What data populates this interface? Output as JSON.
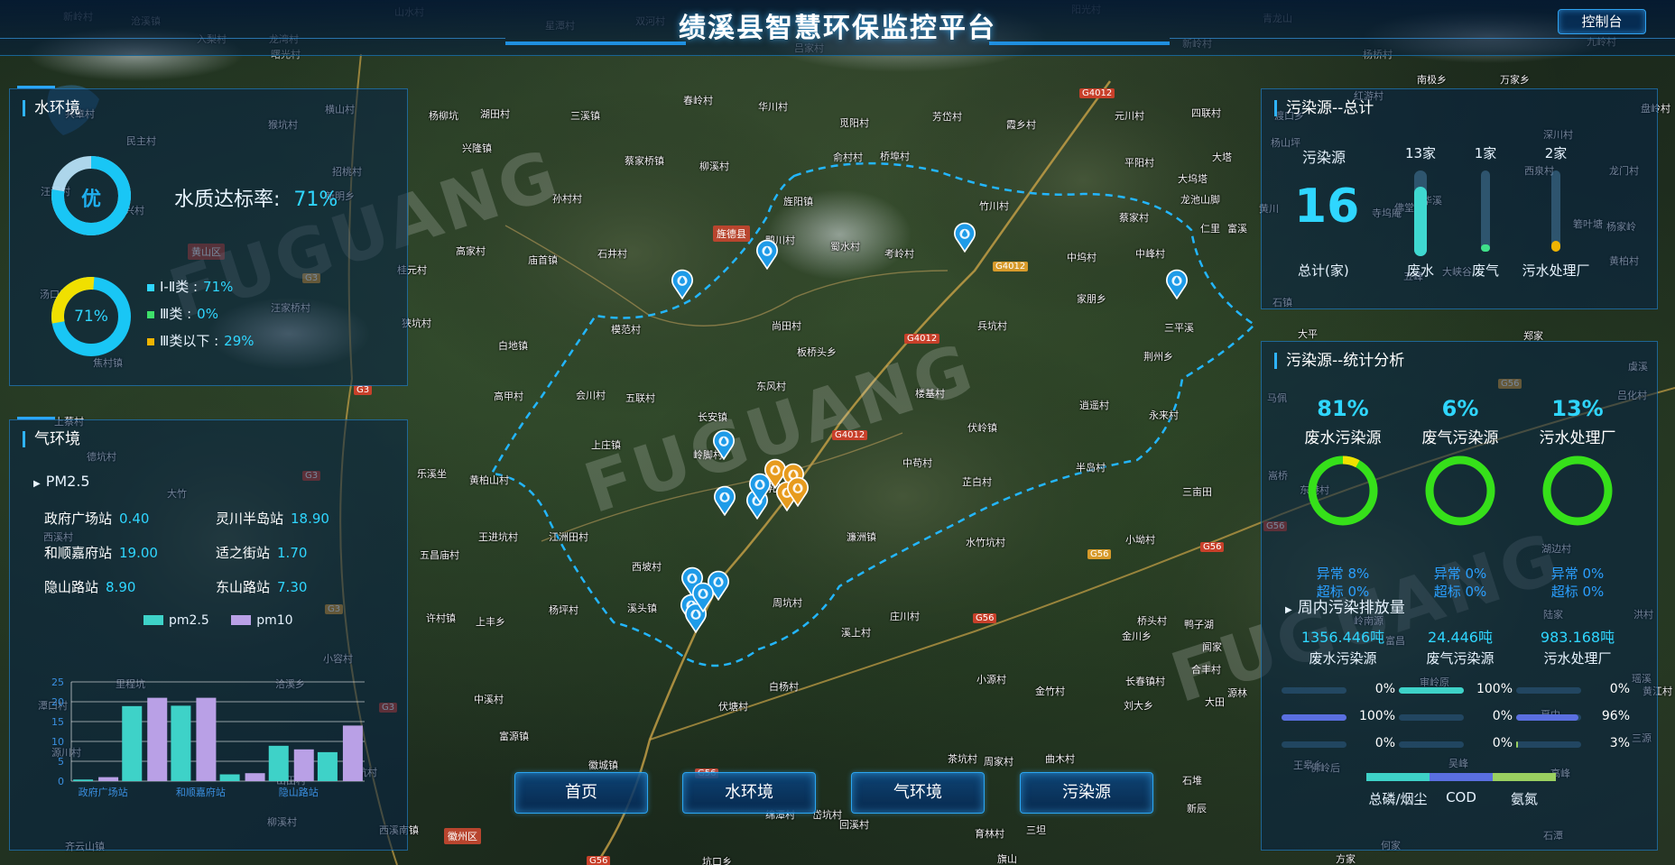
{
  "header": {
    "title": "绩溪县智慧环保监控平台",
    "console_label": "控制台",
    "map_labels_top": [
      "新岭村",
      "沧溪镇",
      "入梨村",
      "龙湾村",
      "山水村",
      "星潭村",
      "双河村",
      "吕家村",
      "阳光村",
      "青龙山",
      "九岭村",
      "杨桥村",
      "曙光村",
      "新岭村"
    ]
  },
  "water": {
    "title": "水环境",
    "grade": "优",
    "rate_label": "水质达标率:",
    "rate_value": "71%",
    "donut_value": "71%",
    "legend": [
      {
        "label": "Ⅰ-Ⅱ类 :",
        "value": "71%",
        "color": "#2fd6ff"
      },
      {
        "label": "Ⅲ类 :",
        "value": "0%",
        "color": "#3ee06a"
      },
      {
        "label": "Ⅲ类以下 :",
        "value": "29%",
        "color": "#f0b400"
      }
    ]
  },
  "air": {
    "title": "气环境",
    "pm_label": "PM2.5",
    "stations": [
      {
        "name": "政府广场站",
        "value": "0.40"
      },
      {
        "name": "灵川半岛站",
        "value": "18.90"
      },
      {
        "name": "和顺嘉府站",
        "value": "19.00"
      },
      {
        "name": "适之街站",
        "value": "1.70"
      },
      {
        "name": "隐山路站",
        "value": "8.90"
      },
      {
        "name": "东山路站",
        "value": "7.30"
      }
    ],
    "legend_pm25": "pm2.5",
    "legend_pm10": "pm10",
    "pm25_color": "#3ed2c8",
    "pm10_color": "#b9a0e6"
  },
  "chart_data": {
    "type": "bar",
    "categories": [
      "政府广场站",
      "灵川半岛站",
      "和顺嘉府站",
      "适之街站",
      "隐山路站",
      "东山路站"
    ],
    "tick_labels": [
      "政府广场站",
      "和顺嘉府站",
      "隐山路站"
    ],
    "series": [
      {
        "name": "pm2.5",
        "values": [
          0.4,
          18.9,
          19.0,
          1.7,
          8.9,
          7.3
        ]
      },
      {
        "name": "pm10",
        "values": [
          1.0,
          21.0,
          21.0,
          2.0,
          8.0,
          14.0
        ]
      }
    ],
    "y_ticks": [
      "0",
      "5",
      "10",
      "15",
      "20",
      "25"
    ],
    "ylim": [
      0,
      25
    ],
    "grid": true,
    "legend": "top"
  },
  "pollution_total": {
    "title": "污染源--总计",
    "source_label": "污染源",
    "total": "16",
    "total_label": "总计(家)",
    "columns": [
      {
        "count": "13家",
        "label": "废水",
        "fill": 0.81,
        "color": "#3fd8d0"
      },
      {
        "count": "1家",
        "label": "废气",
        "fill": 0.06,
        "color": "#3fe08a"
      },
      {
        "count": "2家",
        "label": "污水处理厂",
        "fill": 0.13,
        "color": "#f0b400"
      }
    ]
  },
  "pollution_stats": {
    "title": "污染源--统计分析",
    "items": [
      {
        "pct": "81%",
        "label": "废水污染源",
        "abnormal": "异常 8%",
        "exceed": "超标 0%",
        "ring_fill": 0.08
      },
      {
        "pct": "6%",
        "label": "废气污染源",
        "abnormal": "异常 0%",
        "exceed": "超标 0%",
        "ring_fill": 0
      },
      {
        "pct": "13%",
        "label": "污水处理厂",
        "abnormal": "异常 0%",
        "exceed": "超标 0%",
        "ring_fill": 0
      }
    ],
    "weekly_title": "周内污染排放量",
    "weekly": [
      {
        "amount": "1356.446吨",
        "label": "废水污染源"
      },
      {
        "amount": "24.446吨",
        "label": "废气污染源"
      },
      {
        "amount": "983.168吨",
        "label": "污水处理厂"
      }
    ],
    "bars": [
      [
        {
          "pct": "0%",
          "fill": 0
        },
        {
          "pct": "100%",
          "fill": 1.0
        },
        {
          "pct": "0%",
          "fill": 0
        }
      ],
      [
        {
          "pct": "100%",
          "fill": 1.0
        },
        {
          "pct": "0%",
          "fill": 0
        },
        {
          "pct": "96%",
          "fill": 0.96
        }
      ],
      [
        {
          "pct": "0%",
          "fill": 0
        },
        {
          "pct": "0%",
          "fill": 0
        },
        {
          "pct": "3%",
          "fill": 0.03
        }
      ]
    ],
    "bar_colors": [
      "#3ed2c8",
      "#5a6fe0",
      "#9ad060"
    ],
    "legend": [
      "总磷/烟尘",
      "COD",
      "氨氮"
    ]
  },
  "nav": {
    "home": "首页",
    "water": "水环境",
    "air": "气环境",
    "pollution": "污染源"
  },
  "map": {
    "labels": [
      [
        "共章村",
        72,
        118
      ],
      [
        "民主村",
        140,
        148
      ],
      [
        "汪洞村",
        45,
        204
      ],
      [
        "兴村",
        138,
        225
      ],
      [
        "黄山区",
        208,
        270
      ],
      [
        "汤口镇",
        44,
        318
      ],
      [
        "汪家桥村",
        300,
        333
      ],
      [
        "招桃村",
        368,
        182
      ],
      [
        "新明乡",
        360,
        209
      ],
      [
        "桂元村",
        440,
        291
      ],
      [
        "狭坑村",
        445,
        350
      ],
      [
        "杨柳坑",
        475,
        120
      ],
      [
        "湖田村",
        532,
        118
      ],
      [
        "兴隆镇",
        512,
        156
      ],
      [
        "三溪镇",
        632,
        120
      ],
      [
        "蔡家桥镇",
        692,
        170
      ],
      [
        "孙村村",
        612,
        212
      ],
      [
        "石井村",
        662,
        273
      ],
      [
        "庙首镇",
        585,
        280
      ],
      [
        "高家村",
        505,
        270
      ],
      [
        "白地镇",
        552,
        375
      ],
      [
        "高甲村",
        547,
        431
      ],
      [
        "模范村",
        677,
        357
      ],
      [
        "会川村",
        638,
        430
      ],
      [
        "五联村",
        693,
        433
      ],
      [
        "上庄镇",
        655,
        485
      ],
      [
        "乐溪坐",
        462,
        517
      ],
      [
        "黄柏山村",
        520,
        524
      ],
      [
        "王进坑村",
        530,
        587
      ],
      [
        "五昌庙村",
        465,
        607
      ],
      [
        "许村镇",
        472,
        677
      ],
      [
        "上丰乡",
        527,
        681
      ],
      [
        "中溪村",
        525,
        767
      ],
      [
        "富源镇",
        553,
        808
      ],
      [
        "徽城镇",
        652,
        840
      ],
      [
        "伏塘村",
        796,
        775
      ],
      [
        "春岭村",
        757,
        103
      ],
      [
        "华川村",
        840,
        110
      ],
      [
        "柳溪村",
        775,
        176
      ],
      [
        "旌阳镇",
        868,
        215
      ],
      [
        "鸭川村",
        848,
        258
      ],
      [
        "尚田村",
        855,
        353
      ],
      [
        "板桥头乡",
        883,
        382
      ],
      [
        "东风村",
        838,
        420
      ],
      [
        "长安镇",
        773,
        454
      ],
      [
        "岭脚村",
        768,
        496
      ],
      [
        "乳坑村",
        850,
        533
      ],
      [
        "西坡村",
        700,
        620
      ],
      [
        "溪头镇",
        695,
        666
      ],
      [
        "杨坪村",
        608,
        668
      ],
      [
        "江洲田村",
        608,
        587
      ],
      [
        "周坑村",
        856,
        660
      ],
      [
        "白杨村",
        852,
        753
      ],
      [
        "溪上村",
        932,
        693
      ],
      [
        "庄川村",
        986,
        675
      ],
      [
        "濂洲镇",
        938,
        587
      ],
      [
        "中苟村",
        1000,
        505
      ],
      [
        "芷白村",
        1066,
        526
      ],
      [
        "水竹坑村",
        1070,
        593
      ],
      [
        "伏岭镇",
        1072,
        466
      ],
      [
        "楼基村",
        1014,
        428
      ],
      [
        "兵坑村",
        1083,
        353
      ],
      [
        "家朋乡",
        1193,
        323
      ],
      [
        "中坞村",
        1182,
        277
      ],
      [
        "逍遥村",
        1196,
        441
      ],
      [
        "永来村",
        1273,
        452
      ],
      [
        "半岛村",
        1192,
        510
      ],
      [
        "三亩田",
        1310,
        537
      ],
      [
        "小坳村",
        1247,
        590
      ],
      [
        "桥头村",
        1260,
        680
      ],
      [
        "金川乡",
        1243,
        697
      ],
      [
        "长春镇村",
        1247,
        747
      ],
      [
        "刘大乡",
        1245,
        774
      ],
      [
        "小源村",
        1082,
        745
      ],
      [
        "金竹村",
        1147,
        758
      ],
      [
        "荆州乡",
        1267,
        387
      ],
      [
        "竹川村",
        1085,
        220
      ],
      [
        "觅阳村",
        930,
        128
      ],
      [
        "芳岱村",
        1033,
        121
      ],
      [
        "霞乡村",
        1115,
        130
      ],
      [
        "元川村",
        1235,
        120
      ],
      [
        "四联村",
        1320,
        117
      ],
      [
        "平阳村",
        1246,
        172
      ],
      [
        "龙池山脚",
        1308,
        213
      ],
      [
        "中峰村",
        1258,
        273
      ],
      [
        "大坞塔",
        1305,
        190
      ],
      [
        "桥埠村",
        975,
        165
      ],
      [
        "俞村村",
        923,
        166
      ],
      [
        "蜀水村",
        920,
        265
      ],
      [
        "考岭村",
        980,
        273
      ],
      [
        "蔡家村",
        1240,
        233
      ],
      [
        "三平溪",
        1290,
        355
      ],
      [
        "回溪村",
        930,
        906
      ],
      [
        "坑口乡",
        778,
        947
      ],
      [
        "绵潭村",
        848,
        895
      ],
      [
        "岱坑村",
        900,
        895
      ],
      [
        "茶坑村",
        1050,
        833
      ],
      [
        "育林村",
        1080,
        916
      ],
      [
        "周家村",
        1090,
        836
      ],
      [
        "曲木村",
        1158,
        833
      ],
      [
        "三坦",
        1137,
        912
      ],
      [
        "旗山",
        1105,
        944
      ],
      [
        "石堆",
        1310,
        857
      ],
      [
        "新辰",
        1315,
        888
      ],
      [
        "德坑村",
        96,
        498
      ],
      [
        "大竹",
        185,
        539
      ],
      [
        "齐云山镇",
        72,
        930
      ],
      [
        "西溪南镇",
        420,
        912
      ],
      [
        "柳溪村",
        296,
        903
      ],
      [
        "山田村",
        306,
        857
      ],
      [
        "里程坑",
        128,
        750
      ],
      [
        "洽溪乡",
        305,
        750
      ],
      [
        "潭口村",
        42,
        774
      ],
      [
        "源川村",
        57,
        826
      ],
      [
        "上坑村",
        385,
        848
      ],
      [
        "西溪村",
        48,
        587
      ],
      [
        "小容村",
        358,
        722
      ],
      [
        "横山村",
        360,
        113
      ],
      [
        "猴坑村",
        297,
        130
      ],
      [
        "焦村镇",
        103,
        394
      ],
      [
        "上蔡村",
        60,
        459
      ],
      [
        "东港村",
        1440,
        535
      ],
      [
        "南极乡",
        1570,
        80
      ],
      [
        "万家乡",
        1662,
        80
      ],
      [
        "红游村",
        1500,
        98
      ],
      [
        "盘岭村",
        1818,
        112
      ],
      [
        "深川村",
        1710,
        141
      ],
      [
        "西泉村",
        1689,
        181
      ],
      [
        "龙门村",
        1783,
        181
      ],
      [
        "黄柏村",
        1783,
        281
      ],
      [
        "郑家",
        1688,
        364
      ],
      [
        "虞溪",
        1804,
        398
      ],
      [
        "吕化村",
        1792,
        430
      ],
      [
        "马佩",
        1404,
        433
      ],
      [
        "嵩桥",
        1405,
        519
      ],
      [
        "陆家",
        1710,
        673
      ],
      [
        "洪村",
        1810,
        673
      ],
      [
        "黄江村",
        1820,
        758
      ],
      [
        "石潭",
        1710,
        918
      ],
      [
        "何家",
        1530,
        929
      ],
      [
        "方家",
        1480,
        944
      ],
      [
        "岭南源",
        1500,
        680
      ],
      [
        "湖边村",
        1708,
        600
      ],
      [
        "王皋乡",
        1433,
        840
      ],
      [
        "佛岭后",
        1452,
        843
      ],
      [
        "高峰",
        1718,
        849
      ],
      [
        "吴峰",
        1605,
        838
      ],
      [
        "三源",
        1808,
        810
      ],
      [
        "瑶溪",
        1808,
        744
      ],
      [
        "夏中",
        1707,
        784
      ],
      [
        "审岭原",
        1573,
        748
      ],
      [
        "富昌",
        1535,
        702
      ],
      [
        "黄川",
        1395,
        223
      ],
      [
        "石镇",
        1410,
        327
      ],
      [
        "大平",
        1438,
        362
      ],
      [
        "渡口乡",
        1412,
        120
      ],
      [
        "杨山坪",
        1408,
        150
      ],
      [
        "仁里",
        1330,
        245
      ],
      [
        "大塔",
        1343,
        166
      ],
      [
        "杨家岭",
        1780,
        243
      ],
      [
        "佛堂",
        1545,
        222
      ],
      [
        "五峰",
        1555,
        298
      ],
      [
        "大峡谷",
        1598,
        293
      ],
      [
        "华溪",
        1576,
        214
      ],
      [
        "寺坞庵",
        1520,
        228
      ],
      [
        "箬叶塘",
        1743,
        240
      ],
      [
        "富溪",
        1360,
        245
      ],
      [
        "鸭子湖",
        1312,
        684
      ],
      [
        "闻家",
        1332,
        709
      ],
      [
        "合丰村",
        1320,
        734
      ],
      [
        "大田",
        1335,
        770
      ],
      [
        "源林",
        1360,
        760
      ]
    ],
    "roads": [
      [
        "G4012",
        1196,
        98
      ],
      [
        "G4012",
        1100,
        290
      ],
      [
        "G4012",
        1002,
        370
      ],
      [
        "G4012",
        922,
        477
      ],
      [
        "G3",
        335,
        303
      ],
      [
        "G3",
        392,
        427
      ],
      [
        "G3",
        335,
        522
      ],
      [
        "G3",
        360,
        670
      ],
      [
        "G3",
        420,
        779
      ],
      [
        "G56",
        1078,
        680
      ],
      [
        "G56",
        1205,
        609
      ],
      [
        "G56",
        1330,
        601
      ],
      [
        "G56",
        1400,
        578
      ],
      [
        "G56",
        1660,
        420
      ],
      [
        "G56",
        770,
        852
      ],
      [
        "G56",
        650,
        949
      ]
    ],
    "towns": [
      [
        "旌德县",
        790,
        250
      ],
      [
        "徽州区",
        492,
        918
      ],
      [
        "黄山区",
        208,
        270
      ]
    ]
  }
}
